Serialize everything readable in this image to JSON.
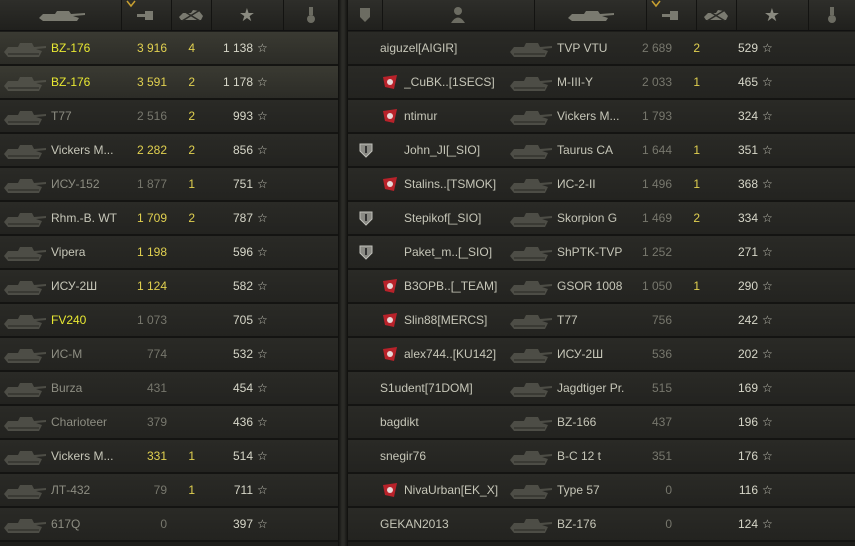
{
  "left_team": [
    {
      "tank": "BZ-176",
      "damage": "3 916",
      "kills": "4",
      "xp": "1 138",
      "name_style": "yellow",
      "dmg_style": "yel",
      "own": true
    },
    {
      "tank": "BZ-176",
      "damage": "3 591",
      "kills": "2",
      "xp": "1 178",
      "name_style": "yellow",
      "dmg_style": "yel",
      "own": true
    },
    {
      "tank": "T77",
      "damage": "2 516",
      "kills": "2",
      "xp": "993",
      "name_style": "dim",
      "dmg_style": "dim2"
    },
    {
      "tank": "Vickers M...",
      "damage": "2 282",
      "kills": "2",
      "xp": "856",
      "name_style": "",
      "dmg_style": "yel"
    },
    {
      "tank": "ИСУ-152",
      "damage": "1 877",
      "kills": "1",
      "xp": "751",
      "name_style": "dim",
      "dmg_style": "dim2"
    },
    {
      "tank": "Rhm.-B. WT",
      "damage": "1 709",
      "kills": "2",
      "xp": "787",
      "name_style": "",
      "dmg_style": "yel"
    },
    {
      "tank": "Vipera",
      "damage": "1 198",
      "kills": "",
      "xp": "596",
      "name_style": "",
      "dmg_style": "yel"
    },
    {
      "tank": "ИСУ-2Ш",
      "damage": "1 124",
      "kills": "",
      "xp": "582",
      "name_style": "",
      "dmg_style": "yel"
    },
    {
      "tank": "FV240",
      "damage": "1 073",
      "kills": "",
      "xp": "705",
      "name_style": "yellow",
      "dmg_style": "dim2"
    },
    {
      "tank": "ИС-М",
      "damage": "774",
      "kills": "",
      "xp": "532",
      "name_style": "dim",
      "dmg_style": "dim2"
    },
    {
      "tank": "Burza",
      "damage": "431",
      "kills": "",
      "xp": "454",
      "name_style": "dim",
      "dmg_style": "dim2"
    },
    {
      "tank": "Charioteer",
      "damage": "379",
      "kills": "",
      "xp": "436",
      "name_style": "dim",
      "dmg_style": "dim2"
    },
    {
      "tank": "Vickers M...",
      "damage": "331",
      "kills": "1",
      "xp": "514",
      "name_style": "",
      "dmg_style": "yel"
    },
    {
      "tank": "ЛТ-432",
      "damage": "79",
      "kills": "1",
      "xp": "711",
      "name_style": "dim",
      "dmg_style": "dim2"
    },
    {
      "tank": "617Q",
      "damage": "0",
      "kills": "",
      "xp": "397",
      "name_style": "dim",
      "dmg_style": "dim2"
    }
  ],
  "right_team": [
    {
      "player": "aiguzel[AIGIR]",
      "badge": "",
      "tank": "TVP VTU",
      "damage": "2 689",
      "kills": "2",
      "xp": "529"
    },
    {
      "player": "_CuBK..[1SECS]",
      "badge": "clan-emblem-icon",
      "tank": "M-III-Y",
      "damage": "2 033",
      "kills": "1",
      "xp": "465"
    },
    {
      "player": "ntimur",
      "badge": "clan-emblem-icon",
      "tank": "Vickers M...",
      "damage": "1 793",
      "kills": "",
      "xp": "324"
    },
    {
      "player": "John_JI[_SIO]",
      "badge": "shield-icon",
      "tank": "Taurus CA",
      "damage": "1 644",
      "kills": "1",
      "xp": "351"
    },
    {
      "player": "Stalins..[TSMOK]",
      "badge": "clan-emblem-icon",
      "tank": "ИС-2-II",
      "damage": "1 496",
      "kills": "1",
      "xp": "368"
    },
    {
      "player": "Stepikof[_SIO]",
      "badge": "shield-icon",
      "tank": "Skorpion G",
      "damage": "1 469",
      "kills": "2",
      "xp": "334"
    },
    {
      "player": "Paket_m..[_SIO]",
      "badge": "shield-icon",
      "tank": "ShPTK-TVP",
      "damage": "1 252",
      "kills": "",
      "xp": "271"
    },
    {
      "player": "B3OPB..[_TEAM]",
      "badge": "clan-emblem-icon",
      "tank": "GSOR 1008",
      "damage": "1 050",
      "kills": "1",
      "xp": "290"
    },
    {
      "player": "Slin88[MERCS]",
      "badge": "clan-emblem-icon",
      "tank": "T77",
      "damage": "756",
      "kills": "",
      "xp": "242"
    },
    {
      "player": "alex744..[KU142]",
      "badge": "clan-emblem-icon",
      "tank": "ИСУ-2Ш",
      "damage": "536",
      "kills": "",
      "xp": "202"
    },
    {
      "player": "S1udent[71DOM]",
      "badge": "",
      "tank": "Jagdtiger Pr.",
      "damage": "515",
      "kills": "",
      "xp": "169"
    },
    {
      "player": "bagdikt",
      "badge": "",
      "tank": "BZ-166",
      "damage": "437",
      "kills": "",
      "xp": "196"
    },
    {
      "player": "snegir76",
      "badge": "",
      "tank": "B-C 12 t",
      "damage": "351",
      "kills": "",
      "xp": "176"
    },
    {
      "player": "NivaUrban[EK_X]",
      "badge": "clan-emblem-icon",
      "tank": "Type 57",
      "damage": "0",
      "kills": "",
      "xp": "116"
    },
    {
      "player": "GEKAN2013",
      "badge": "",
      "tank": "BZ-176",
      "damage": "0",
      "kills": "",
      "xp": "124"
    }
  ],
  "icons": {
    "star": "☆"
  }
}
